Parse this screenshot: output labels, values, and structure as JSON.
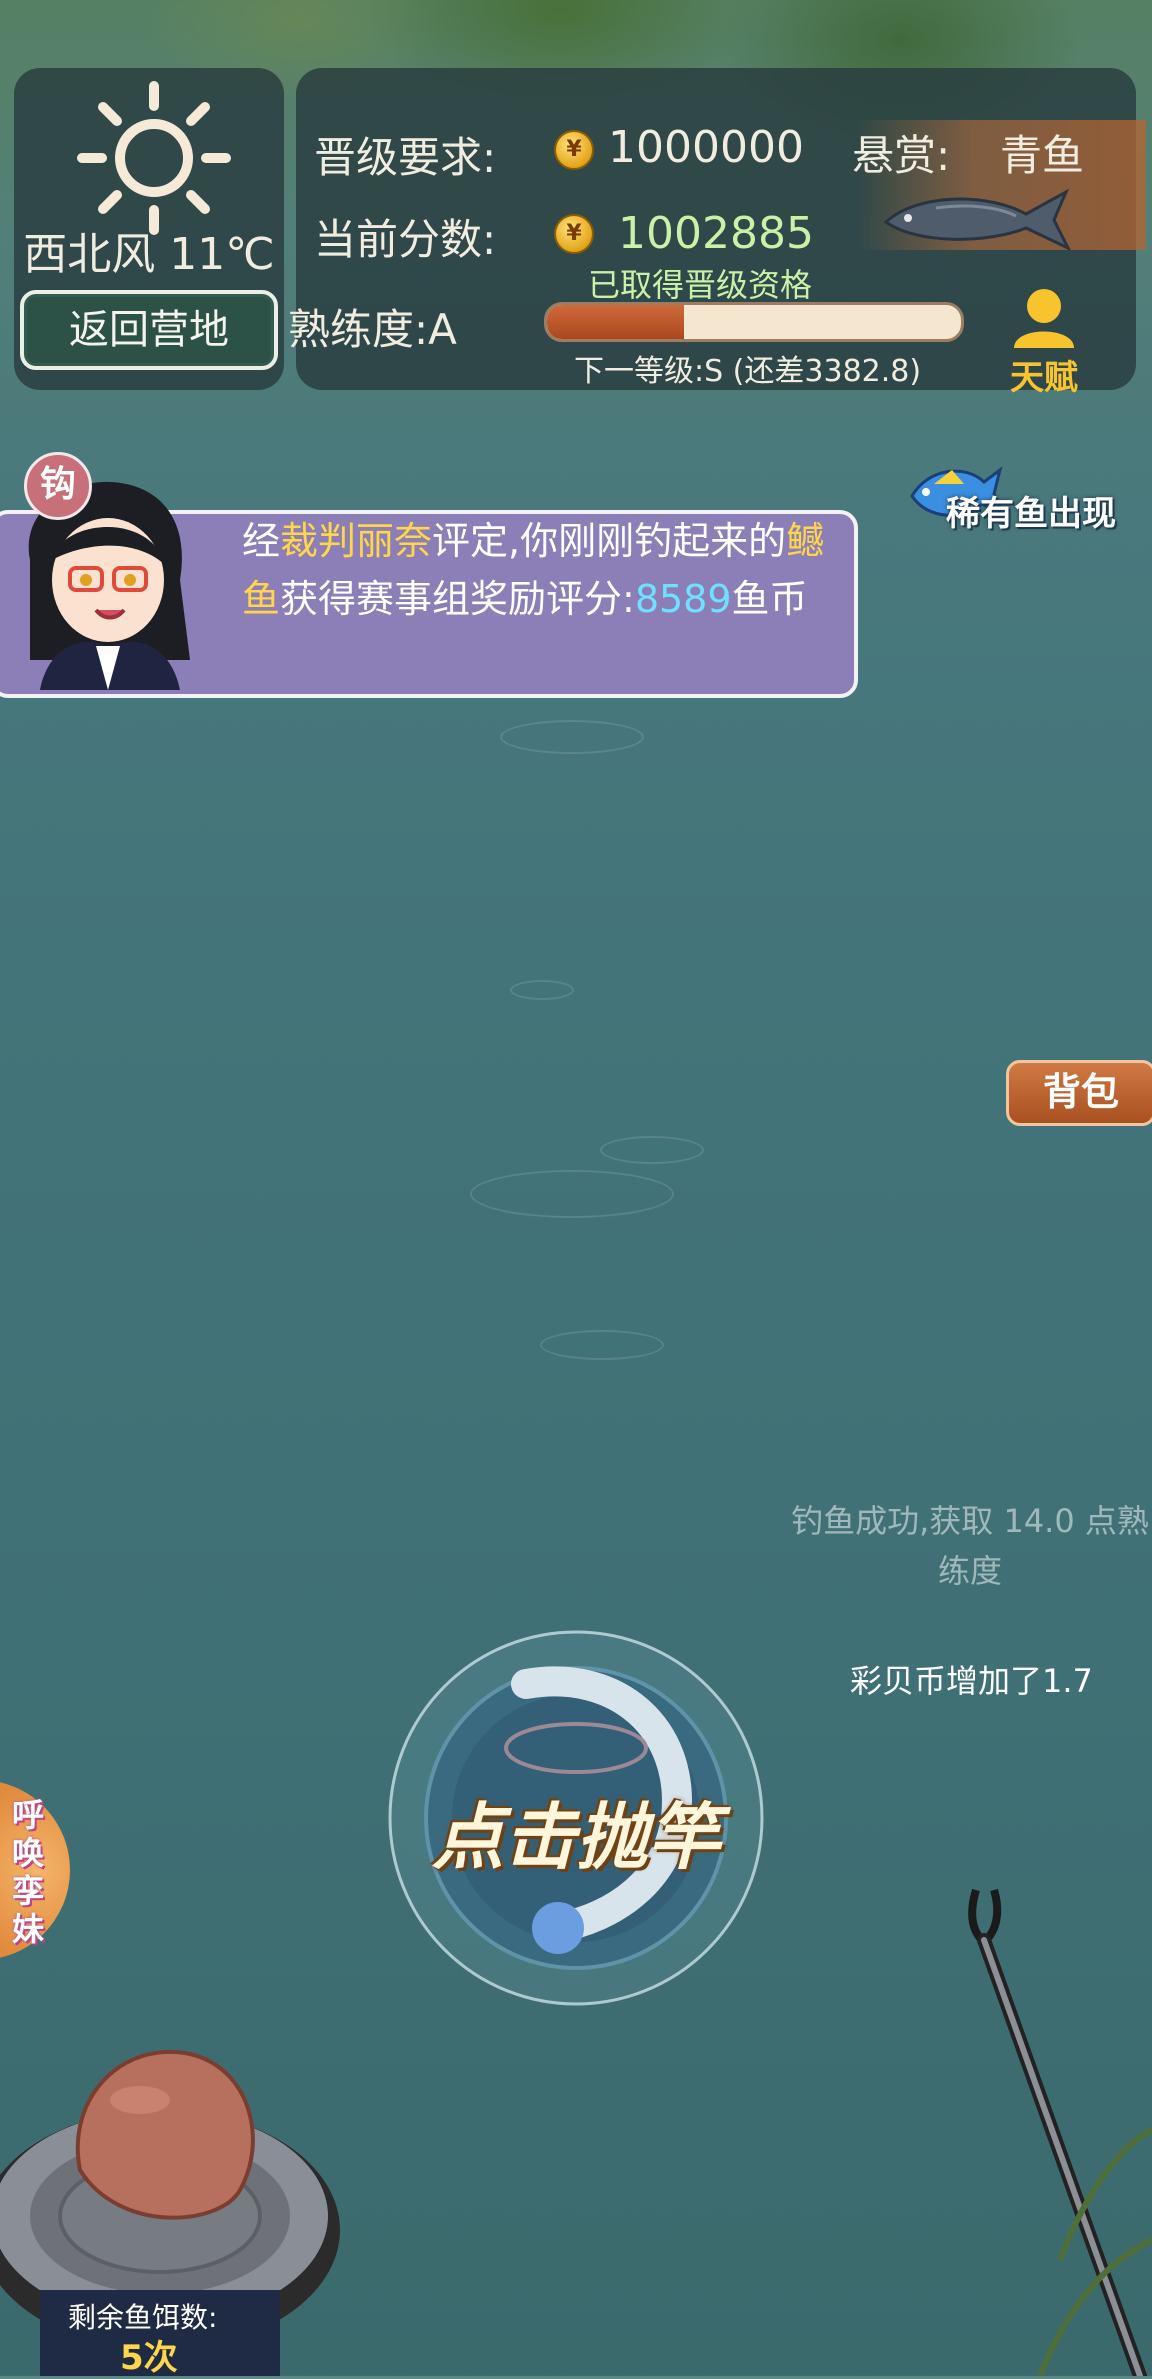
{
  "weather": {
    "icon": "sun-icon",
    "text": "西北风 11℃"
  },
  "camp_button": "返回营地",
  "info": {
    "promotion_label": "晋级要求:",
    "promotion_value": "1000000",
    "bounty_label": "悬赏:",
    "bounty_fish": "青鱼",
    "score_label": "当前分数:",
    "score_value": "1002885",
    "qualified_text": "已取得晋级资格",
    "proficiency_label": "熟练度:A",
    "progress_fraction": 0.33,
    "next_level_text": "下一等级:S (还差3382.8)",
    "talent_label": "天赋",
    "coin_glyph": "¥"
  },
  "rare_fish_label": "稀有鱼出现",
  "hook_badge": "钩",
  "message": {
    "part1": "经",
    "judge": "裁判丽奈",
    "part2": "评定,你刚刚钓起来的",
    "fish": "鳡鱼",
    "part3": "获得赛事组奖励评分:",
    "score": "8589",
    "part4": "鱼币"
  },
  "backpack_button": "背包",
  "notices": {
    "fishing_success": "钓鱼成功,获取 14.0 点熟练度",
    "shell_coins": "彩贝币增加了1.7"
  },
  "cast_button": "点击抛竿",
  "summon_label": "呼唤孪妹",
  "bait": {
    "label": "剩余鱼饵数:",
    "count": "5次"
  },
  "colors": {
    "water": "#437479",
    "panel": "#283c3e",
    "banner": "#8c7fb8",
    "highlight_yellow": "#ffd54a",
    "highlight_blue": "#6fe1ff",
    "qualified_green": "#c9f2a8",
    "progress_fill": "#b9552a"
  }
}
